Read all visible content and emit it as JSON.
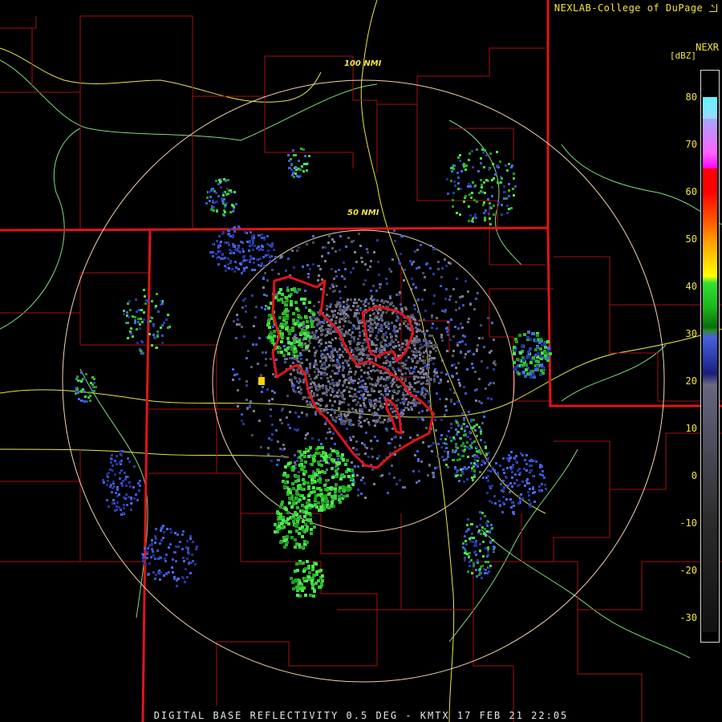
{
  "header": {
    "credit": "NEXLAB-College of DuPage",
    "credit_icon": "arrow-corner-icon"
  },
  "legend": {
    "product": "NEXR",
    "unit": "[dBZ]",
    "ticks": [
      "80",
      "70",
      "60",
      "50",
      "40",
      "30",
      "20",
      "10",
      "0",
      "-10",
      "-20",
      "-30"
    ],
    "colors": {
      "ground": "#000000",
      "state_border": "#e0141a",
      "county_line": "#a31010",
      "highway": "#e8e84a",
      "river": "#7fdc7f",
      "range_ring": "#f3d3b0",
      "warning_polygon": "#e0141a"
    }
  },
  "range_rings": {
    "inner": "50 NMI",
    "outer": "100 NMI"
  },
  "footer": {
    "caption": "DIGITAL BASE REFLECTIVITY 0.5 DEG - KMTX 17 FEB 21 22:05"
  }
}
